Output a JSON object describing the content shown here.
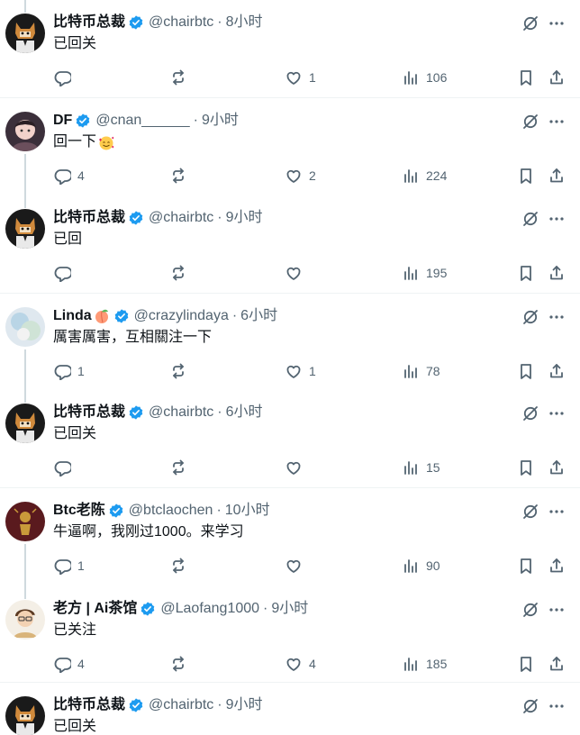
{
  "colors": {
    "text_primary": "#0f1419",
    "text_secondary": "#536471",
    "verified_blue": "#1d9bf0",
    "divider": "#eff3f4",
    "thread_line": "#cfd9de"
  },
  "tweets": [
    {
      "avatar": "fox-avatar",
      "name": "比特币总裁",
      "name_emoji": "",
      "handle": "@chairbtc",
      "time": "8小时",
      "text": "已回关",
      "text_emoji": "",
      "reply_count": "",
      "retweet_count": "",
      "like_count": "1",
      "view_count": "106"
    },
    {
      "avatar": "anime-boy-avatar",
      "name": "DF",
      "name_emoji": "",
      "handle": "@cnan______",
      "time": "9小时",
      "text": "回一下",
      "text_emoji": "smiling-face-with-hearts-emoji",
      "reply_count": "4",
      "retweet_count": "",
      "like_count": "2",
      "view_count": "224"
    },
    {
      "avatar": "fox-avatar",
      "name": "比特币总裁",
      "name_emoji": "",
      "handle": "@chairbtc",
      "time": "9小时",
      "text": "已回",
      "text_emoji": "",
      "reply_count": "",
      "retweet_count": "",
      "like_count": "",
      "view_count": "195"
    },
    {
      "avatar": "pastel-avatar",
      "name": "Linda",
      "name_emoji": "peach-emoji",
      "handle": "@crazylindaya",
      "time": "6小时",
      "text": "厲害厲害，互相關注一下",
      "text_emoji": "",
      "reply_count": "1",
      "retweet_count": "",
      "like_count": "1",
      "view_count": "78"
    },
    {
      "avatar": "fox-avatar",
      "name": "比特币总裁",
      "name_emoji": "",
      "handle": "@chairbtc",
      "time": "6小时",
      "text": "已回关",
      "text_emoji": "",
      "reply_count": "",
      "retweet_count": "",
      "like_count": "",
      "view_count": "15"
    },
    {
      "avatar": "dark-red-avatar",
      "name": "Btc老陈",
      "name_emoji": "",
      "handle": "@btclaochen",
      "time": "10小时",
      "text": "牛逼啊，我刚过1000。来学习",
      "text_emoji": "",
      "reply_count": "1",
      "retweet_count": "",
      "like_count": "",
      "view_count": "90"
    },
    {
      "avatar": "cartoon-man-avatar",
      "name": "老方 | Ai茶馆",
      "name_emoji": "",
      "handle": "@Laofang1000",
      "time": "9小时",
      "text": "已关注",
      "text_emoji": "",
      "reply_count": "4",
      "retweet_count": "",
      "like_count": "4",
      "view_count": "185"
    },
    {
      "avatar": "fox-avatar",
      "name": "比特币总裁",
      "name_emoji": "",
      "handle": "@chairbtc",
      "time": "9小时",
      "text": "已回关",
      "text_emoji": "",
      "reply_count": "",
      "retweet_count": "",
      "like_count": "",
      "view_count": ""
    }
  ]
}
